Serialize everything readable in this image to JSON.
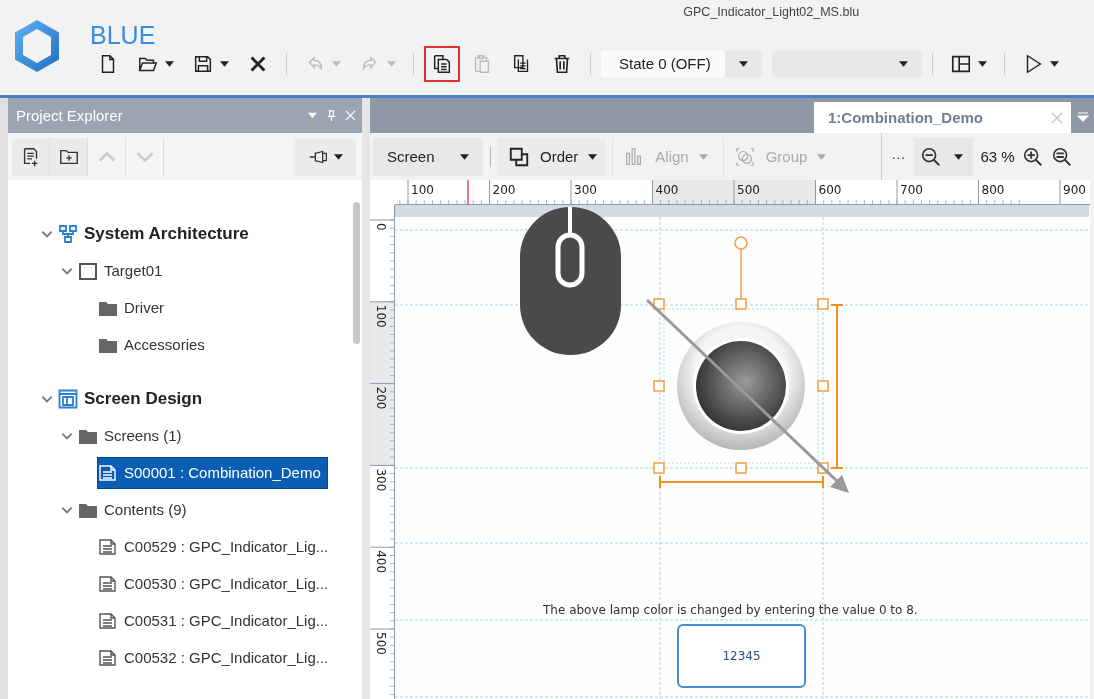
{
  "app": {
    "name": "BLUE",
    "file_name": "GPC_Indicator_Light02_MS.blu"
  },
  "toolbar": [
    {
      "kind": "new",
      "disabled": false,
      "highlighted": false,
      "dropdown": false
    },
    {
      "kind": "open",
      "disabled": false,
      "highlighted": false,
      "dropdown": true
    },
    {
      "kind": "save",
      "disabled": false,
      "highlighted": false,
      "dropdown": true
    },
    {
      "kind": "close",
      "disabled": false,
      "highlighted": false,
      "dropdown": false
    },
    {
      "kind": "separator"
    },
    {
      "kind": "undo",
      "disabled": true,
      "highlighted": false,
      "dropdown": true
    },
    {
      "kind": "redo",
      "disabled": true,
      "highlighted": false,
      "dropdown": true
    },
    {
      "kind": "separator"
    },
    {
      "kind": "copy",
      "disabled": false,
      "highlighted": true,
      "dropdown": false
    },
    {
      "kind": "paste",
      "disabled": true,
      "highlighted": false,
      "dropdown": false
    },
    {
      "kind": "duplicate",
      "disabled": false,
      "highlighted": false,
      "dropdown": false
    },
    {
      "kind": "delete",
      "disabled": false,
      "highlighted": false,
      "dropdown": false
    },
    {
      "kind": "separator"
    },
    {
      "kind": "combo",
      "value": "State 0 (OFF)"
    },
    {
      "kind": "combo"
    },
    {
      "kind": "separator"
    },
    {
      "kind": "layout",
      "disabled": false,
      "highlighted": false,
      "dropdown": true
    },
    {
      "kind": "separator"
    },
    {
      "kind": "play",
      "disabled": false,
      "highlighted": false,
      "dropdown": true
    }
  ],
  "panel": {
    "title": "Project Explorer"
  },
  "tree": [
    {
      "label": "System Architecture",
      "kind": "architecture",
      "expanded": true,
      "selected": false,
      "children": [
        {
          "label": "Target01",
          "kind": "target",
          "expanded": true,
          "selected": false,
          "children": [
            {
              "label": "Driver",
              "kind": "folder",
              "selected": false
            },
            {
              "label": "Accessories",
              "kind": "folder",
              "selected": false
            }
          ]
        }
      ]
    },
    {
      "label": "Screen Design",
      "kind": "screen",
      "expanded": true,
      "selected": false,
      "children": [
        {
          "label": "Screens (1)",
          "kind": "folder",
          "expanded": true,
          "selected": false,
          "children": [
            {
              "label": "S00001 : Combination_Demo",
              "kind": "document",
              "selected": true
            }
          ]
        },
        {
          "label": "Contents (9)",
          "kind": "folder",
          "expanded": true,
          "selected": false,
          "children": [
            {
              "label": "C00529 : GPC_Indicator_Lig...",
              "kind": "document",
              "selected": false
            },
            {
              "label": "C00530 : GPC_Indicator_Lig...",
              "kind": "document",
              "selected": false
            },
            {
              "label": "C00531 : GPC_Indicator_Lig...",
              "kind": "document",
              "selected": false
            },
            {
              "label": "C00532 : GPC_Indicator_Lig...",
              "kind": "document",
              "selected": false
            }
          ]
        }
      ]
    }
  ],
  "tabs": [
    {
      "label": "1:Combination_Demo",
      "selected": true
    }
  ],
  "editor_toolbar": [
    {
      "kind": "select",
      "label": "Screen"
    },
    {
      "kind": "separator"
    },
    {
      "kind": "order",
      "label": "Order",
      "disabled": false
    },
    {
      "kind": "align",
      "label": "Align",
      "disabled": true
    },
    {
      "kind": "group",
      "label": "Group",
      "disabled": true
    },
    {
      "kind": "more",
      "label": "···"
    },
    {
      "kind": "zoom-out"
    },
    {
      "kind": "zoom-level",
      "label": "63 %"
    },
    {
      "kind": "zoom-in"
    },
    {
      "kind": "zoom-fit"
    }
  ],
  "ruler": {
    "x_labels": [
      "100",
      "200",
      "300",
      "400",
      "500",
      "600",
      "700",
      "800",
      "900"
    ],
    "y_labels": [
      "0",
      "100",
      "200",
      "300",
      "400",
      "500"
    ]
  },
  "canvas": {
    "lamp": {
      "selected": true
    },
    "caption": "The above lamp color is changed by entering the value 0 to 8.",
    "input": {
      "value": "12345"
    }
  }
}
